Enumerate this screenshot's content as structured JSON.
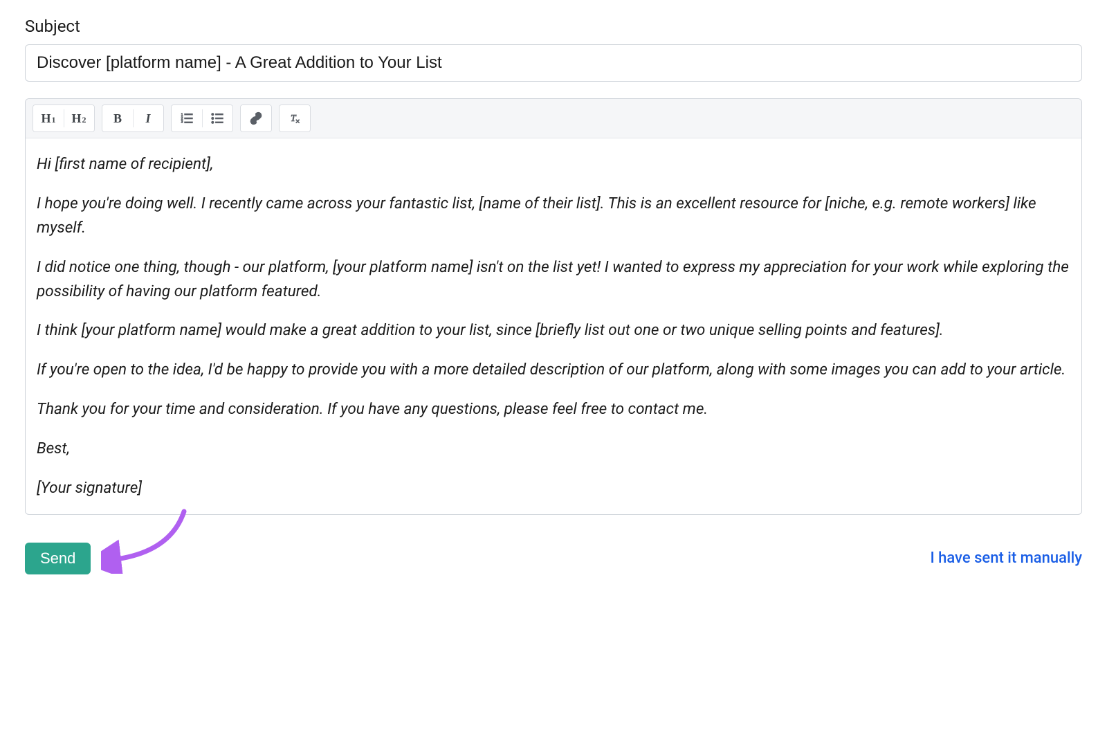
{
  "subject": {
    "label": "Subject",
    "value": "Discover [platform name] - A Great Addition to Your List"
  },
  "toolbar": {
    "h1": "H",
    "h1_sub": "1",
    "h2": "H",
    "h2_sub": "2",
    "bold": "B",
    "italic": "I",
    "ol_name": "ordered-list",
    "ul_name": "unordered-list",
    "link_name": "link",
    "clear_name": "clear-formatting"
  },
  "body": {
    "p1": "Hi [first name of recipient],",
    "p2": "I hope you're doing well. I recently came across your fantastic list, [name of their list]. This is an excellent resource for [niche, e.g. remote workers] like myself.",
    "p3": "I did notice one thing, though - our platform, [your platform name] isn't on the list yet! I wanted to express my appreciation for your work while exploring the possibility of having our platform featured.",
    "p4": "I think [your platform name] would make a great addition to your list, since [briefly list out one or two unique selling points and features].",
    "p5": "If you're open to the idea, I'd be happy to provide you with a more detailed description of our platform, along with some images you can add to your article.",
    "p6": "Thank you for your time and consideration. If you have any questions, please feel free to contact me.",
    "p7": "Best,",
    "p8": "[Your signature]"
  },
  "actions": {
    "send": "Send",
    "manual": "I have sent it manually"
  }
}
